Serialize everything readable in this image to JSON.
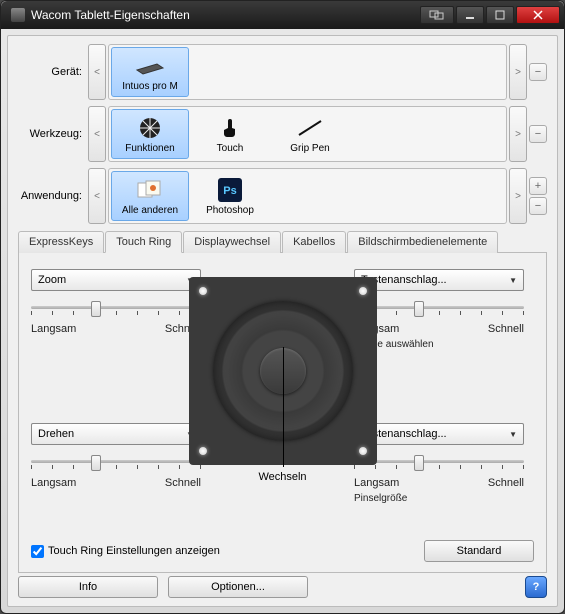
{
  "window": {
    "title": "Wacom Tablett-Eigenschaften"
  },
  "rows": {
    "device_label": "Gerät:",
    "tool_label": "Werkzeug:",
    "app_label": "Anwendung:"
  },
  "devices": [
    {
      "name": "Intuos pro M",
      "selected": true
    }
  ],
  "tools": [
    {
      "name": "Funktionen",
      "selected": true
    },
    {
      "name": "Touch",
      "selected": false
    },
    {
      "name": "Grip Pen",
      "selected": false
    }
  ],
  "apps": [
    {
      "name": "Alle anderen",
      "selected": true
    },
    {
      "name": "Photoshop",
      "selected": false
    }
  ],
  "tabs": [
    "ExpressKeys",
    "Touch Ring",
    "Displaywechsel",
    "Kabellos",
    "Bildschirmbedienelemente"
  ],
  "active_tab": 1,
  "touchring": {
    "switch_label": "Wechseln",
    "slider_min": "Langsam",
    "slider_max": "Schnell",
    "quads": {
      "tl": {
        "combo": "Zoom",
        "subtext": ""
      },
      "tr": {
        "combo": "Tastenanschlag...",
        "subtext": "Ebene auswählen"
      },
      "bl": {
        "combo": "Drehen",
        "subtext": ""
      },
      "br": {
        "combo": "Tastenanschlag...",
        "subtext": "Pinselgröße"
      }
    },
    "show_settings_label": "Touch Ring Einstellungen anzeigen",
    "show_settings_checked": true,
    "default_button": "Standard"
  },
  "bottom": {
    "info": "Info",
    "options": "Optionen..."
  }
}
